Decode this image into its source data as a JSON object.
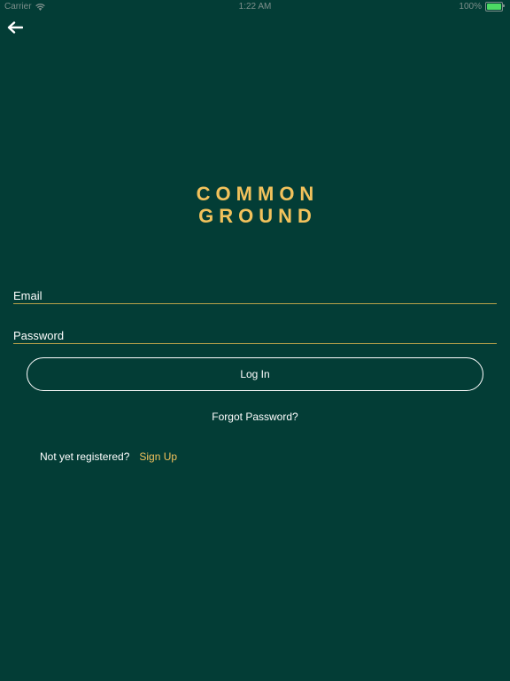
{
  "status_bar": {
    "carrier": "Carrier",
    "time": "1:22 AM",
    "battery_text": "100%",
    "battery_level": 1.0,
    "battery_color": "#4cd964",
    "wifi_icon": "wifi-icon",
    "battery_icon": "battery-icon"
  },
  "nav": {
    "back_icon": "back-arrow-icon"
  },
  "logo": {
    "line1": "COMMON",
    "line2": "GROUND",
    "color": "#f2c25c"
  },
  "form": {
    "email_placeholder": "Email",
    "email_value": "",
    "password_placeholder": "Password",
    "password_value": "",
    "login_label": "Log In",
    "forgot_label": "Forgot Password?"
  },
  "register": {
    "prompt": "Not yet registered?",
    "signup_label": "Sign Up"
  },
  "colors": {
    "background": "#033d36",
    "accent": "#f2c25c",
    "underline": "#b9a24a"
  }
}
